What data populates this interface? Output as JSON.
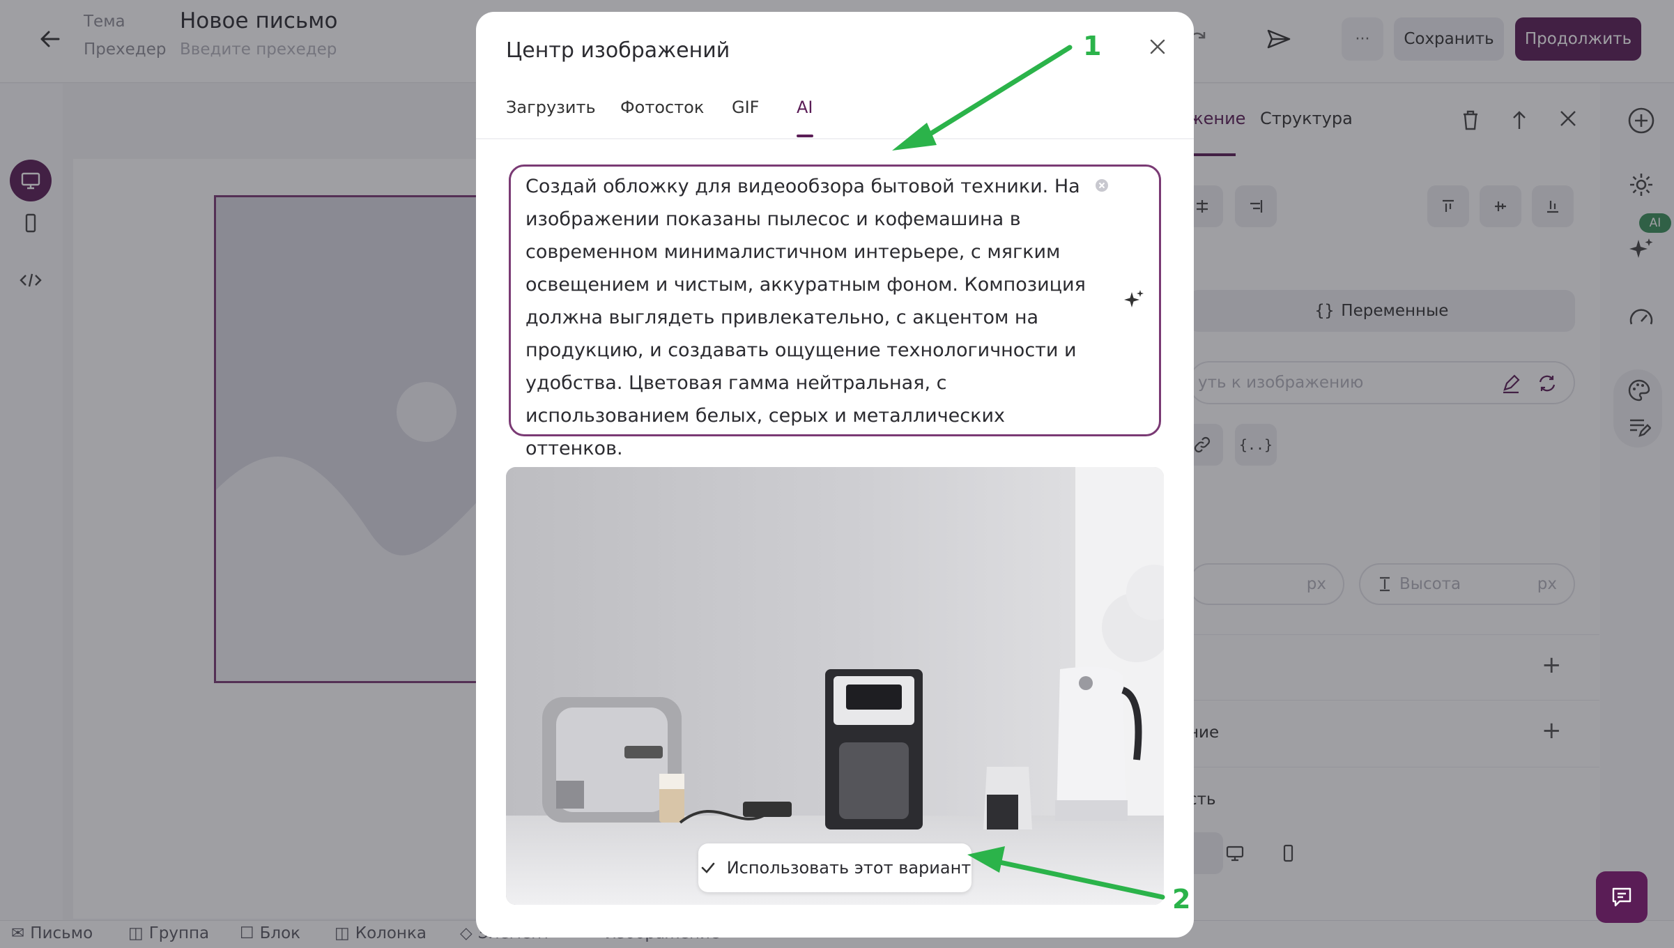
{
  "header": {
    "subject_label": "Тема",
    "subject_value": "Новое письмо",
    "preheader_label": "Прехедер",
    "preheader_placeholder": "Введите прехедер",
    "more_label": "···",
    "save_label": "Сохранить",
    "continue_label": "Продолжить"
  },
  "right_panel": {
    "tab_content": "жение",
    "tab_structure": "Структура",
    "variables_label": "Переменные",
    "image_path_placeholder": "уть к изображению",
    "width_unit": "px",
    "height_placeholder": "Высота",
    "height_unit": "px",
    "row1_label": "",
    "row2_label": "ние",
    "row3_label": "сть",
    "ai_badge": "AI"
  },
  "breadcrumbs": [
    "Письмо",
    "Группа",
    "Блок",
    "Колонка",
    "Элемент",
    "Изображение"
  ],
  "modal": {
    "title": "Центр изображений",
    "tabs": [
      "Загрузить",
      "Фотосток",
      "GIF",
      "AI"
    ],
    "active_tab": "AI",
    "prompt_text": "Создай обложку для видеообзора бытовой техники. На изображении показаны пылесос и кофемашина в современном минималистичном интерьере, с мягким освещением и чистым, аккуратным фоном. Композиция должна выглядеть привлекательно, с акцентом на продукцию, и создавать ощущение технологичности и удобства. Цветовая гамма нейтральная, с использованием белых, серых и металлических оттенков.",
    "use_variant_label": "Использовать этот вариант"
  },
  "annotations": {
    "marker_1": "1",
    "marker_2": "2"
  },
  "colors": {
    "accent": "#5a1d56",
    "annotation": "#2bb34a"
  }
}
